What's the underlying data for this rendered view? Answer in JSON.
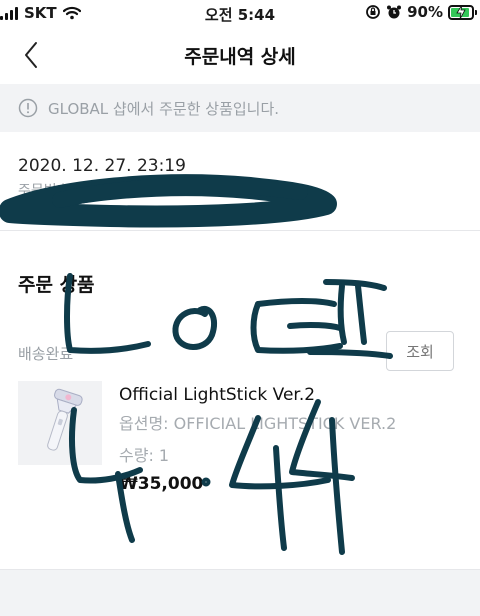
{
  "status_bar": {
    "carrier": "SKT",
    "time": "오전 5:44",
    "battery_percent": "90%",
    "battery_level": 0.9
  },
  "nav": {
    "back_icon": "chevron-left-icon",
    "title": "주문내역 상세"
  },
  "notice": {
    "icon": "info-circle-icon",
    "text": "GLOBAL 샵에서 주문한 상품입니다."
  },
  "order": {
    "date": "2020. 12. 27. 23:19",
    "number_label": "주문번호"
  },
  "section": {
    "title": "주문 상품"
  },
  "shipment": {
    "status": "배송완료",
    "lookup_label": "조회"
  },
  "product": {
    "name": "Official LightStick Ver.2",
    "option": "옵션명: OFFICIAL LIGHTSTICK VER.2",
    "quantity": "수량: 1",
    "price": "₩35,000"
  },
  "colors": {
    "scribble_ink": "#0f3b4a",
    "battery_fill": "#34c759",
    "muted_text": "#9aa0a6",
    "notice_bg": "#f2f3f5"
  }
}
